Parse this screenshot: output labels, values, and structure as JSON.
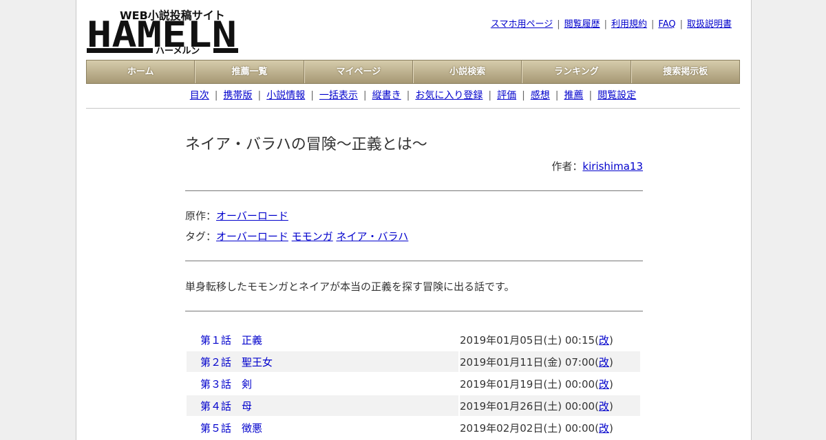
{
  "logo": {
    "tagline": "WEB小説投稿サイト",
    "name": "HAMELN",
    "kana": "ハーメルン"
  },
  "toplinks": [
    "スマホ用ページ",
    "閲覧履歴",
    "利用規約",
    "FAQ",
    "取扱説明書"
  ],
  "gnav": [
    "ホーム",
    "推薦一覧",
    "マイページ",
    "小説検索",
    "ランキング",
    "捜索掲示板"
  ],
  "subnav": [
    "目次",
    "携帯版",
    "小説情報",
    "一括表示",
    "縦書き",
    "お気に入り登録",
    "評価",
    "感想",
    "推薦",
    "閲覧設定"
  ],
  "novel": {
    "title": "ネイア・バラハの冒険～正義とは～",
    "author_label": "作者：",
    "author": "kirishima13",
    "original_label": "原作：",
    "original": "オーバーロード",
    "tags_label": "タグ：",
    "tags": [
      "オーバーロード",
      "モモンガ",
      "ネイア・バラハ"
    ],
    "summary": "単身転移したモモンガとネイアが本当の正義を探す冒険に出る話です。"
  },
  "episodes": [
    {
      "title": "第１話　正義",
      "date": "2019年01月05日(土) 00:15",
      "rev": "改"
    },
    {
      "title": "第２話　聖王女",
      "date": "2019年01月11日(金) 07:00",
      "rev": "改"
    },
    {
      "title": "第３話　剣",
      "date": "2019年01月19日(土) 00:00",
      "rev": "改"
    },
    {
      "title": "第４話　母",
      "date": "2019年01月26日(土) 00:00",
      "rev": "改"
    },
    {
      "title": "第５話　徴悪",
      "date": "2019年02月02日(土) 00:00",
      "rev": "改"
    }
  ],
  "colors": {
    "nav_top": "#d6ccac",
    "nav_bottom": "#a69874",
    "link": "#0000cc"
  }
}
